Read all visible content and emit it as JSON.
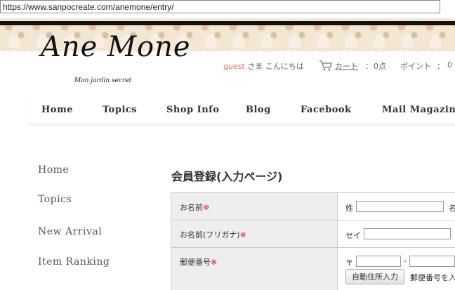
{
  "browser": {
    "url": "https://www.sanpocreate.com/anemone/entry/"
  },
  "logo": {
    "main": "Ane Mone",
    "sub": "Mon jardin secret"
  },
  "header": {
    "guest": "guest",
    "greeting": " さま  こんにちは",
    "cart_label": "カート",
    "colon": "：",
    "cart_count": "0点",
    "point_label": "ポイント",
    "point_value": "0"
  },
  "nav": {
    "items": [
      "Home",
      "Topics",
      "Shop Info",
      "Blog",
      "Facebook",
      "Mail Magazine"
    ]
  },
  "sidebar": {
    "items": [
      "Home",
      "Topics",
      "New Arrival",
      "Item Ranking"
    ]
  },
  "form": {
    "title": "会員登録(入力ページ)",
    "required_mark": "※",
    "name_label": "お名前",
    "name_sei": "姓",
    "name_mei": "名",
    "kana_label": "お名前(フリガナ)",
    "kana_sei": "セイ",
    "zip_label": "郵便番号",
    "zip_mark": "〒",
    "zip_dash": "-",
    "auto_address_button": "自動住所入力",
    "auto_address_hint": "郵便番号を入"
  },
  "colors": {
    "guest": "#e06b4a",
    "required": "#ee0000"
  }
}
